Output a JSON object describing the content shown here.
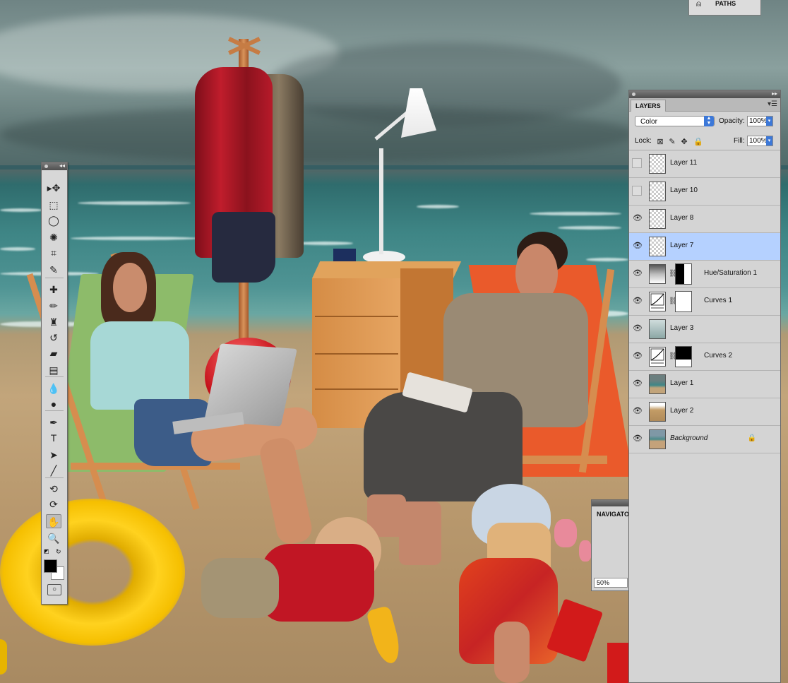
{
  "tools_panel": {
    "tools": [
      {
        "name": "move-tool",
        "glyph": "▸✥"
      },
      {
        "name": "marquee-tool",
        "glyph": "⬚"
      },
      {
        "name": "lasso-tool",
        "glyph": "◯"
      },
      {
        "name": "quick-selection-tool",
        "glyph": "✺"
      },
      {
        "name": "crop-tool",
        "glyph": "⌗"
      },
      {
        "name": "eyedropper-tool",
        "glyph": "✎"
      },
      {
        "name": "healing-brush-tool",
        "glyph": "✚"
      },
      {
        "name": "brush-tool",
        "glyph": "✏"
      },
      {
        "name": "clone-stamp-tool",
        "glyph": "♜"
      },
      {
        "name": "history-brush-tool",
        "glyph": "↺"
      },
      {
        "name": "eraser-tool",
        "glyph": "▰"
      },
      {
        "name": "gradient-tool",
        "glyph": "▤"
      },
      {
        "name": "blur-tool",
        "glyph": "💧"
      },
      {
        "name": "dodge-tool",
        "glyph": "●"
      },
      {
        "name": "pen-tool",
        "glyph": "✒"
      },
      {
        "name": "type-tool",
        "glyph": "T"
      },
      {
        "name": "path-selection-tool",
        "glyph": "➤"
      },
      {
        "name": "line-tool",
        "glyph": "╱"
      },
      {
        "name": "3d-rotate-tool",
        "glyph": "⟲"
      },
      {
        "name": "3d-orbit-tool",
        "glyph": "⟳"
      },
      {
        "name": "hand-tool",
        "glyph": "✋"
      },
      {
        "name": "zoom-tool",
        "glyph": "🔍"
      }
    ]
  },
  "layers_panel": {
    "tab_label": "LAYERS",
    "blend_mode": "Color",
    "opacity_label": "Opacity:",
    "opacity_value": "100%",
    "lock_label": "Lock:",
    "fill_label": "Fill:",
    "fill_value": "100%",
    "layers": [
      {
        "name": "Layer 11",
        "visible": false,
        "thumb": "transparent",
        "selected": false
      },
      {
        "name": "Layer 10",
        "visible": false,
        "thumb": "transparent",
        "selected": false
      },
      {
        "name": "Layer 8",
        "visible": true,
        "thumb": "transparent-sand",
        "selected": false
      },
      {
        "name": "Layer 7",
        "visible": true,
        "thumb": "transparent-peach",
        "selected": true
      },
      {
        "name": "Hue/Saturation 1",
        "visible": true,
        "thumb": "adjustment-hue",
        "mask": "black-white",
        "selected": false
      },
      {
        "name": "Curves 1",
        "visible": true,
        "thumb": "adjustment-curves",
        "mask": "white",
        "selected": false
      },
      {
        "name": "Layer 3",
        "visible": true,
        "thumb": "sea",
        "selected": false
      },
      {
        "name": "Curves 2",
        "visible": true,
        "thumb": "adjustment-curves",
        "mask": "black-white-bottom",
        "selected": false
      },
      {
        "name": "Layer 1",
        "visible": true,
        "thumb": "sea-sky",
        "selected": false
      },
      {
        "name": "Layer 2",
        "visible": true,
        "thumb": "sand",
        "selected": false
      },
      {
        "name": "Background",
        "visible": true,
        "thumb": "beach",
        "selected": false,
        "italic": true,
        "locked": true
      }
    ]
  },
  "navigator_panel": {
    "title": "NAVIGATO",
    "zoom": "50%"
  },
  "paths_panel": {
    "title": "PATHS"
  },
  "colors": {
    "selection": "#b5d1ff",
    "accent": "#3c78d8",
    "panel": "#d4d4d4"
  }
}
